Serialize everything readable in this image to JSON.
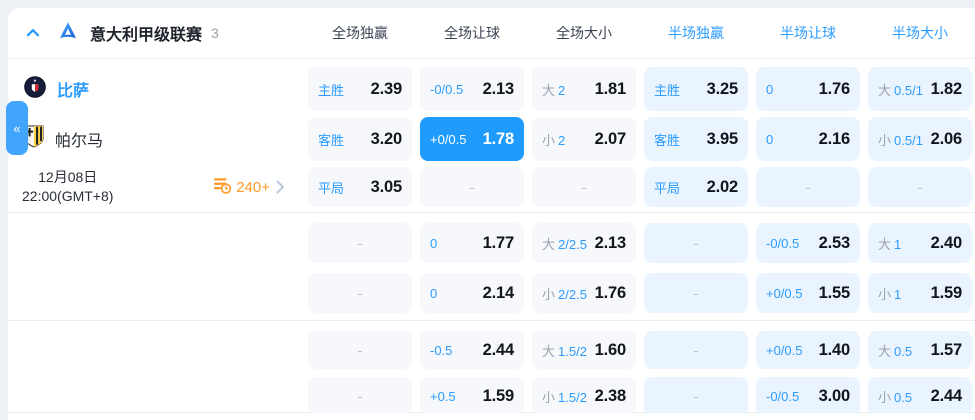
{
  "page": {
    "collapse_tab": "«"
  },
  "header": {
    "league_title": "意大利甲级联赛",
    "match_count": "3",
    "columns": [
      {
        "label": "全场独赢",
        "group": "full"
      },
      {
        "label": "全场让球",
        "group": "full"
      },
      {
        "label": "全场大小",
        "group": "full"
      },
      {
        "label": "半场独赢",
        "group": "half"
      },
      {
        "label": "半场让球",
        "group": "half"
      },
      {
        "label": "半场大小",
        "group": "half"
      }
    ]
  },
  "match": {
    "home": "比萨",
    "away": "帕尔马",
    "date_line1": "12月08日",
    "date_line2": "22:00(GMT+8)",
    "markets_count": "240+"
  },
  "colors": {
    "accent_blue": "#2b9cfd",
    "highlight_cell": "#1e9bfc",
    "halftime_cell_bg": "#eaf4fe",
    "fulltime_cell_bg": "#f6f8fb",
    "orange": "#ff9a26"
  },
  "odds": {
    "dash": "-",
    "rows": [
      {
        "cells": [
          {
            "pre": "",
            "label": "主胜",
            "value": "2.39"
          },
          {
            "pre": "",
            "label": "-0/0.5",
            "value": "2.13"
          },
          {
            "pre": "大",
            "label": "2",
            "value": "1.81"
          },
          {
            "pre": "",
            "label": "主胜",
            "value": "3.25"
          },
          {
            "pre": "",
            "label": "0",
            "value": "1.76"
          },
          {
            "pre": "大",
            "label": "0.5/1",
            "value": "1.82"
          }
        ]
      },
      {
        "cells": [
          {
            "pre": "",
            "label": "客胜",
            "value": "3.20"
          },
          {
            "pre": "",
            "label": "+0/0.5",
            "value": "1.78",
            "highlight": true
          },
          {
            "pre": "小",
            "label": "2",
            "value": "2.07"
          },
          {
            "pre": "",
            "label": "客胜",
            "value": "3.95"
          },
          {
            "pre": "",
            "label": "0",
            "value": "2.16"
          },
          {
            "pre": "小",
            "label": "0.5/1",
            "value": "2.06"
          }
        ]
      },
      {
        "cells": [
          {
            "pre": "",
            "label": "平局",
            "value": "3.05"
          },
          null,
          null,
          {
            "pre": "",
            "label": "平局",
            "value": "2.02"
          },
          null,
          null
        ]
      },
      {
        "cells": [
          null,
          {
            "pre": "",
            "label": "0",
            "value": "1.77"
          },
          {
            "pre": "大",
            "label": "2/2.5",
            "value": "2.13"
          },
          null,
          {
            "pre": "",
            "label": "-0/0.5",
            "value": "2.53"
          },
          {
            "pre": "大",
            "label": "1",
            "value": "2.40"
          }
        ]
      },
      {
        "cells": [
          null,
          {
            "pre": "",
            "label": "0",
            "value": "2.14"
          },
          {
            "pre": "小",
            "label": "2/2.5",
            "value": "1.76"
          },
          null,
          {
            "pre": "",
            "label": "+0/0.5",
            "value": "1.55"
          },
          {
            "pre": "小",
            "label": "1",
            "value": "1.59"
          }
        ]
      },
      {
        "cells": [
          null,
          {
            "pre": "",
            "label": "-0.5",
            "value": "2.44"
          },
          {
            "pre": "大",
            "label": "1.5/2",
            "value": "1.60"
          },
          null,
          {
            "pre": "",
            "label": "+0/0.5",
            "value": "1.40"
          },
          {
            "pre": "大",
            "label": "0.5",
            "value": "1.57"
          }
        ]
      },
      {
        "cells": [
          null,
          {
            "pre": "",
            "label": "+0.5",
            "value": "1.59"
          },
          {
            "pre": "小",
            "label": "1.5/2",
            "value": "2.38"
          },
          null,
          {
            "pre": "",
            "label": "-0/0.5",
            "value": "3.00"
          },
          {
            "pre": "小",
            "label": "0.5",
            "value": "2.44"
          }
        ]
      }
    ]
  }
}
